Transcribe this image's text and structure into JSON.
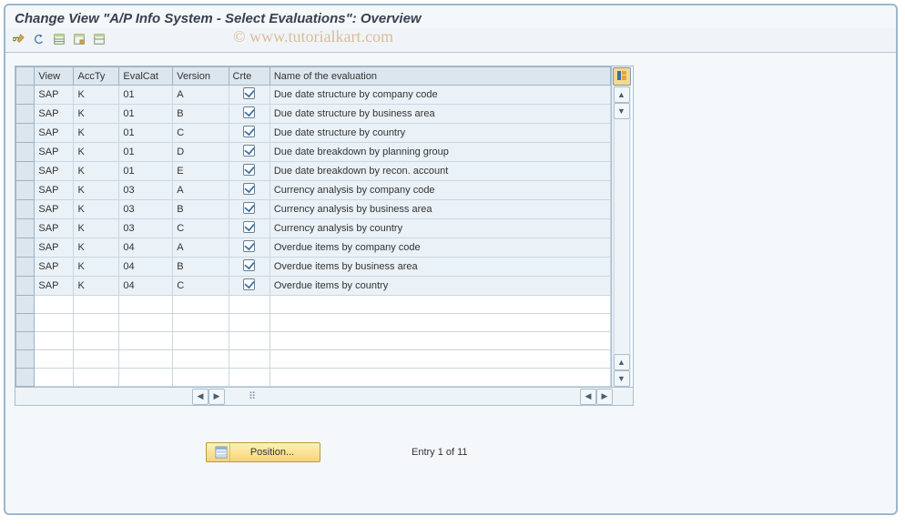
{
  "window": {
    "title": "Change View \"A/P Info System - Select Evaluations\": Overview"
  },
  "watermark": "© www.tutorialkart.com",
  "toolbar": {
    "icons": [
      "edit",
      "select",
      "save",
      "import",
      "export"
    ]
  },
  "table": {
    "headers": {
      "sel": "",
      "view": "View",
      "accty": "AccTy",
      "evalcat": "EvalCat",
      "version": "Version",
      "crte": "Crte",
      "name": "Name of the evaluation"
    },
    "rows": [
      {
        "view": "SAP",
        "accty": "K",
        "evalcat": "01",
        "version": "A",
        "crte": true,
        "name": "Due date structure by company code"
      },
      {
        "view": "SAP",
        "accty": "K",
        "evalcat": "01",
        "version": "B",
        "crte": true,
        "name": "Due date structure by business area"
      },
      {
        "view": "SAP",
        "accty": "K",
        "evalcat": "01",
        "version": "C",
        "crte": true,
        "name": "Due date structure by country"
      },
      {
        "view": "SAP",
        "accty": "K",
        "evalcat": "01",
        "version": "D",
        "crte": true,
        "name": "Due date breakdown by planning group"
      },
      {
        "view": "SAP",
        "accty": "K",
        "evalcat": "01",
        "version": "E",
        "crte": true,
        "name": "Due date breakdown by recon. account"
      },
      {
        "view": "SAP",
        "accty": "K",
        "evalcat": "03",
        "version": "A",
        "crte": true,
        "name": "Currency analysis by company code"
      },
      {
        "view": "SAP",
        "accty": "K",
        "evalcat": "03",
        "version": "B",
        "crte": true,
        "name": "Currency analysis by business area"
      },
      {
        "view": "SAP",
        "accty": "K",
        "evalcat": "03",
        "version": "C",
        "crte": true,
        "name": "Currency analysis by country"
      },
      {
        "view": "SAP",
        "accty": "K",
        "evalcat": "04",
        "version": "A",
        "crte": true,
        "name": "Overdue items by company code"
      },
      {
        "view": "SAP",
        "accty": "K",
        "evalcat": "04",
        "version": "B",
        "crte": true,
        "name": "Overdue items by business area"
      },
      {
        "view": "SAP",
        "accty": "K",
        "evalcat": "04",
        "version": "C",
        "crte": true,
        "name": "Overdue items by country"
      }
    ],
    "emptyRows": 5
  },
  "footer": {
    "position_label": "Position...",
    "entry_text": "Entry 1 of 11"
  }
}
